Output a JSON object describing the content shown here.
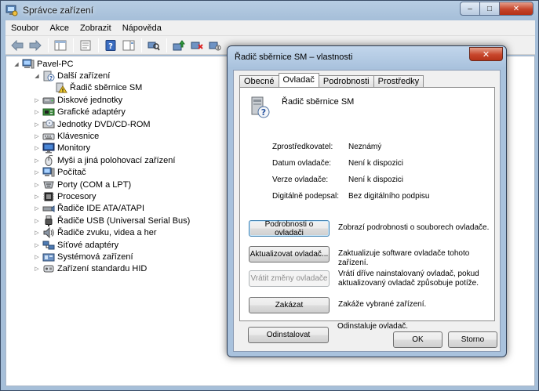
{
  "window": {
    "title": "Správce zařízení",
    "caption": {
      "minimize": "–",
      "maximize": "□",
      "close": "✕"
    }
  },
  "menu": [
    {
      "label": "Soubor"
    },
    {
      "label": "Akce"
    },
    {
      "label": "Zobrazit"
    },
    {
      "label": "Nápověda"
    }
  ],
  "tree": {
    "root": "Pavel-PC",
    "items": [
      {
        "label": "Další zařízení",
        "expander": "◢",
        "icon": "other-devices-icon"
      },
      {
        "label": "Řadič sběrnice SM",
        "expander": "",
        "icon": "warning-device-icon"
      },
      {
        "label": "Diskové jednotky",
        "expander": "▷",
        "icon": "disk-drive-icon"
      },
      {
        "label": "Grafické adaptéry",
        "expander": "▷",
        "icon": "display-adapter-icon"
      },
      {
        "label": "Jednotky DVD/CD-ROM",
        "expander": "▷",
        "icon": "dvd-drive-icon"
      },
      {
        "label": "Klávesnice",
        "expander": "▷",
        "icon": "keyboard-icon"
      },
      {
        "label": "Monitory",
        "expander": "▷",
        "icon": "monitor-icon"
      },
      {
        "label": "Myši a jiná polohovací zařízení",
        "expander": "▷",
        "icon": "mouse-icon"
      },
      {
        "label": "Počítač",
        "expander": "▷",
        "icon": "computer-icon"
      },
      {
        "label": "Porty (COM a LPT)",
        "expander": "▷",
        "icon": "port-icon"
      },
      {
        "label": "Procesory",
        "expander": "▷",
        "icon": "processor-icon"
      },
      {
        "label": "Řadiče IDE ATA/ATAPI",
        "expander": "▷",
        "icon": "ide-controller-icon"
      },
      {
        "label": "Řadiče USB (Universal Serial Bus)",
        "expander": "▷",
        "icon": "usb-icon"
      },
      {
        "label": "Řadiče zvuku, videa a her",
        "expander": "▷",
        "icon": "sound-icon"
      },
      {
        "label": "Síťové adaptéry",
        "expander": "▷",
        "icon": "network-adapter-icon"
      },
      {
        "label": "Systémová zařízení",
        "expander": "▷",
        "icon": "system-devices-icon"
      },
      {
        "label": "Zařízení standardu HID",
        "expander": "▷",
        "icon": "hid-icon"
      }
    ]
  },
  "dialog": {
    "title": "Řadič sběrnice SM  – vlastnosti",
    "close": "✕",
    "tabs": [
      {
        "label": "Obecné",
        "active": false
      },
      {
        "label": "Ovladač",
        "active": true
      },
      {
        "label": "Podrobnosti",
        "active": false
      },
      {
        "label": "Prostředky",
        "active": false
      }
    ],
    "device_name": "Řadič sběrnice SM",
    "properties": [
      {
        "label": "Zprostředkovatel:",
        "value": "Neznámý"
      },
      {
        "label": "Datum ovladače:",
        "value": "Není k dispozici"
      },
      {
        "label": "Verze ovladače:",
        "value": "Není k dispozici"
      },
      {
        "label": "Digitálně podepsal:",
        "value": "Bez digitálního podpisu"
      }
    ],
    "actions": [
      {
        "button": "Podrobnosti o ovladači",
        "desc": "Zobrazí podrobnosti o souborech ovladače."
      },
      {
        "button": "Aktualizovat ovladač...",
        "desc": "Zaktualizuje software ovladače tohoto zařízení."
      },
      {
        "button": "Vrátit změny ovladače",
        "desc": "Vrátí dříve nainstalovaný ovladač, pokud aktualizovaný ovladač způsobuje potíže."
      },
      {
        "button": "Zakázat",
        "desc": "Zakáže vybrané zařízení."
      },
      {
        "button": "Odinstalovat",
        "desc": "Odinstaluje ovladač."
      }
    ],
    "ok": "OK",
    "cancel": "Storno"
  }
}
